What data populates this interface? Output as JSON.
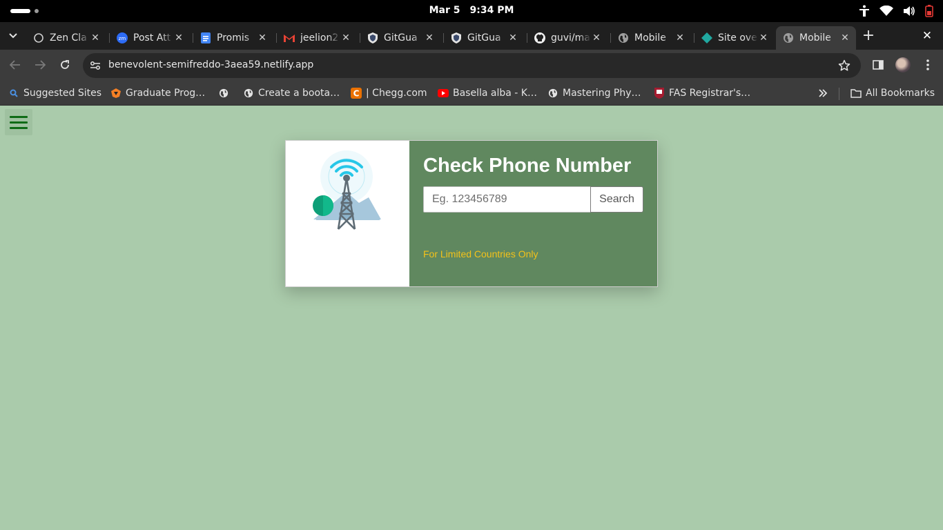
{
  "os": {
    "date": "Mar 5",
    "time": "9:34 PM"
  },
  "tabs": [
    {
      "title": "Zen Cla",
      "icon": "loading-icon"
    },
    {
      "title": "Post Att",
      "icon": "zoom-icon"
    },
    {
      "title": "Promis",
      "icon": "google-docs-icon"
    },
    {
      "title": "jeelion2",
      "icon": "gmail-icon"
    },
    {
      "title": "GitGua",
      "icon": "gitguardian-icon"
    },
    {
      "title": "GitGua",
      "icon": "gitguardian-icon"
    },
    {
      "title": "guvi/ma",
      "icon": "github-icon"
    },
    {
      "title": "Mobile",
      "icon": "globe-icon"
    },
    {
      "title": "Site ove",
      "icon": "netlify-icon"
    },
    {
      "title": "Mobile",
      "icon": "globe-icon",
      "active": true
    }
  ],
  "toolbar": {
    "url": "benevolent-semifreddo-3aea59.netlify.app"
  },
  "bookmarks": [
    {
      "label": "Suggested Sites",
      "icon": "search-icon"
    },
    {
      "label": "Graduate Prog…",
      "icon": "princeton-icon"
    },
    {
      "label": "",
      "icon": "globe-icon"
    },
    {
      "label": "Create a boota…",
      "icon": "globe-icon"
    },
    {
      "label": "| Chegg.com",
      "icon": "chegg-icon"
    },
    {
      "label": "Basella alba - K…",
      "icon": "youtube-icon"
    },
    {
      "label": "Mastering Phy…",
      "icon": "globe-icon"
    },
    {
      "label": "FAS Registrar's…",
      "icon": "harvard-icon"
    }
  ],
  "all_bookmarks": "All Bookmarks",
  "card": {
    "title": "Check Phone Number",
    "input_placeholder": "Eg. 123456789",
    "search_label": "Search",
    "note": "For Limited Countries Only"
  },
  "colors": {
    "page_bg": "#aacbab",
    "card_panel": "#60885f",
    "note_text": "#f4c21a",
    "hamburger": "#0f6b16"
  }
}
